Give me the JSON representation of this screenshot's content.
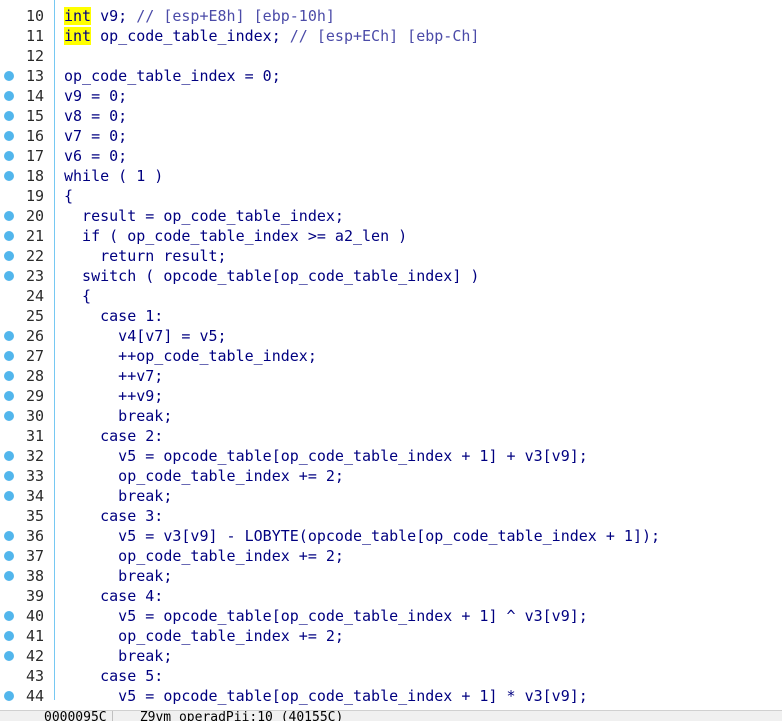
{
  "lines": [
    {
      "num": "10",
      "dot": false
    },
    {
      "num": "11",
      "dot": false
    },
    {
      "num": "12",
      "dot": false
    },
    {
      "num": "13",
      "dot": true
    },
    {
      "num": "14",
      "dot": true
    },
    {
      "num": "15",
      "dot": true
    },
    {
      "num": "16",
      "dot": true
    },
    {
      "num": "17",
      "dot": true
    },
    {
      "num": "18",
      "dot": true
    },
    {
      "num": "19",
      "dot": false
    },
    {
      "num": "20",
      "dot": true
    },
    {
      "num": "21",
      "dot": true
    },
    {
      "num": "22",
      "dot": true
    },
    {
      "num": "23",
      "dot": true
    },
    {
      "num": "24",
      "dot": false
    },
    {
      "num": "25",
      "dot": false
    },
    {
      "num": "26",
      "dot": true
    },
    {
      "num": "27",
      "dot": true
    },
    {
      "num": "28",
      "dot": true
    },
    {
      "num": "29",
      "dot": true
    },
    {
      "num": "30",
      "dot": true
    },
    {
      "num": "31",
      "dot": false
    },
    {
      "num": "32",
      "dot": true
    },
    {
      "num": "33",
      "dot": true
    },
    {
      "num": "34",
      "dot": true
    },
    {
      "num": "35",
      "dot": false
    },
    {
      "num": "36",
      "dot": true
    },
    {
      "num": "37",
      "dot": true
    },
    {
      "num": "38",
      "dot": true
    },
    {
      "num": "39",
      "dot": false
    },
    {
      "num": "40",
      "dot": true
    },
    {
      "num": "41",
      "dot": true
    },
    {
      "num": "42",
      "dot": true
    },
    {
      "num": "43",
      "dot": false
    },
    {
      "num": "44",
      "dot": true
    }
  ],
  "code": {
    "l10": {
      "kw": "int",
      "rest": " v9; ",
      "comment": "// [esp+E8h] [ebp-10h]"
    },
    "l11": {
      "kw": "int",
      "rest": " op_code_table_index; ",
      "comment": "// [esp+ECh] [ebp-Ch]"
    },
    "l13": "op_code_table_index = 0;",
    "l14": "v9 = 0;",
    "l15": "v8 = 0;",
    "l16": "v7 = 0;",
    "l17": "v6 = 0;",
    "l18": "while ( 1 )",
    "l19": "{",
    "l20": "  result = op_code_table_index;",
    "l21": "  if ( op_code_table_index >= a2_len )",
    "l22": "    return result;",
    "l23": "  switch ( opcode_table[op_code_table_index] )",
    "l24": "  {",
    "l25": "    case 1:",
    "l26": "      v4[v7] = v5;",
    "l27": "      ++op_code_table_index;",
    "l28": "      ++v7;",
    "l29": "      ++v9;",
    "l30": "      break;",
    "l31": "    case 2:",
    "l32": "      v5 = opcode_table[op_code_table_index + 1] + v3[v9];",
    "l33": "      op_code_table_index += 2;",
    "l34": "      break;",
    "l35": "    case 3:",
    "l36": "      v5 = v3[v9] - LOBYTE(opcode_table[op_code_table_index + 1]);",
    "l37": "      op_code_table_index += 2;",
    "l38": "      break;",
    "l39": "    case 4:",
    "l40": "      v5 = opcode_table[op_code_table_index + 1] ^ v3[v9];",
    "l41": "      op_code_table_index += 2;",
    "l42": "      break;",
    "l43": "    case 5:",
    "l44": "      v5 = opcode_table[op_code_table_index + 1] * v3[v9];"
  },
  "status": {
    "address": "0000095C",
    "location": "_Z9vm_operadPii:10 (40155C)"
  },
  "colors": {
    "dot": "#52b6ec",
    "keyword": "#000080",
    "variable": "#4b4ba8",
    "highlight": "#ffff00"
  }
}
